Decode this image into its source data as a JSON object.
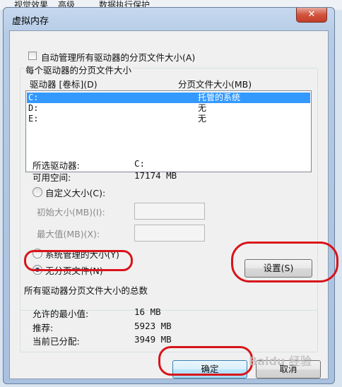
{
  "background_tabs": [
    "视觉效果",
    "高级",
    "数据执行保护"
  ],
  "dialog": {
    "title": "虚拟内存",
    "close_glyph": "✕"
  },
  "auto_manage": {
    "label": "自动管理所有驱动器的分页文件大小(A)",
    "checked": false
  },
  "per_drive": {
    "group_label": "每个驱动器的分页文件大小",
    "col_drive": "驱动器 [卷标](D)",
    "col_size": "分页文件大小(MB)",
    "rows": [
      {
        "drive": "C:",
        "size": "托管的系统",
        "selected": true
      },
      {
        "drive": "D:",
        "size": "无",
        "selected": false
      },
      {
        "drive": "E:",
        "size": "无",
        "selected": false
      }
    ],
    "selected_drive_label": "所选驱动器:",
    "selected_drive_value": "C:",
    "free_space_label": "可用空间:",
    "free_space_value": "17174 MB",
    "custom_size_label": "自定义大小(C):",
    "initial_size_label": "初始大小(MB)(I):",
    "max_size_label": "最大值(MB)(X):",
    "initial_size_value": "",
    "max_size_value": "",
    "system_managed_label": "系统管理的大小(Y)",
    "no_paging_label": "无分页文件(N)",
    "selected_option": "no_paging",
    "set_button": "设置(S)"
  },
  "totals": {
    "group_label": "所有驱动器分页文件大小的总数",
    "min_label": "允许的最小值:",
    "min_value": "16 MB",
    "recommended_label": "推荐:",
    "recommended_value": "5923 MB",
    "allocated_label": "当前已分配:",
    "allocated_value": "3949 MB"
  },
  "buttons": {
    "ok": "确定",
    "cancel": "取消"
  },
  "watermark": "Baidu 经验",
  "colors": {
    "selection": "#3399ff",
    "annotation": "#d8141a",
    "close": "#c94430"
  }
}
